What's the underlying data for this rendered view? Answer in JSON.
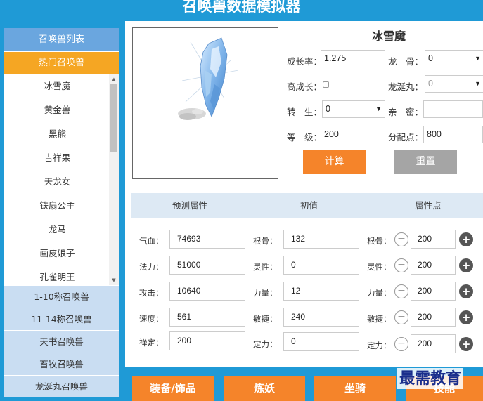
{
  "header": {
    "title": "召唤兽数据模拟器"
  },
  "sidebar": {
    "title": "召唤兽列表",
    "hot_label": "热门召唤兽",
    "pets": [
      "冰雪魔",
      "黄金兽",
      "黑熊",
      "吉祥果",
      "天龙女",
      "铁扇公主",
      "龙马",
      "画皮娘子",
      "孔雀明王"
    ],
    "categories": [
      "1-10称召唤兽",
      "11-14称召唤兽",
      "天书召唤兽",
      "畜牧召唤兽",
      "龙涎丸召唤兽"
    ]
  },
  "pet": {
    "name": "冰雪魔",
    "growth_label": "成长率：",
    "growth_value": "1.275",
    "dragon_bone_label": "龙　骨：",
    "dragon_bone_value": "0",
    "high_growth_label": "高成长：",
    "dragon_pill_label": "龙涎丸：",
    "dragon_pill_value": "0",
    "rebirth_label": "转　生：",
    "rebirth_value": "0",
    "intimacy_label": "亲　密：",
    "intimacy_value": "",
    "level_label": "等　级：",
    "level_value": "200",
    "points_label": "分配点：",
    "points_value": "800"
  },
  "buttons": {
    "calc": "计算",
    "reset": "重置"
  },
  "table": {
    "col_predict": "预测属性",
    "col_initial": "初值",
    "col_points": "属性点",
    "rows": [
      {
        "pred_label": "气血：",
        "pred_value": "74693",
        "init_label": "根骨：",
        "init_value": "132",
        "pt_label": "根骨：",
        "pt_value": "200"
      },
      {
        "pred_label": "法力：",
        "pred_value": "51000",
        "init_label": "灵性：",
        "init_value": "0",
        "pt_label": "灵性：",
        "pt_value": "200"
      },
      {
        "pred_label": "攻击：",
        "pred_value": "10640",
        "init_label": "力量：",
        "init_value": "12",
        "pt_label": "力量：",
        "pt_value": "200"
      },
      {
        "pred_label": "速度：",
        "pred_value": "561",
        "init_label": "敏捷：",
        "init_value": "240",
        "pt_label": "敏捷：",
        "pt_value": "200"
      },
      {
        "pred_label": "禅定：",
        "pred_value": "200",
        "init_label": "定力：",
        "init_value": "0",
        "pt_label": "定力：",
        "pt_value": "200"
      }
    ]
  },
  "bottom_tabs": [
    "装备/饰品",
    "炼妖",
    "坐骑",
    "技能"
  ],
  "watermark": "最需教育",
  "icons": {
    "minus": "minus-circle-icon",
    "plus": "plus-circle-icon",
    "select": "chevron-down-icon"
  },
  "colors": {
    "accent_orange": "#f5842a",
    "hot_orange": "#f5a623",
    "bg_blue": "#1f9ad6",
    "head_blue": "#6aa6df"
  }
}
